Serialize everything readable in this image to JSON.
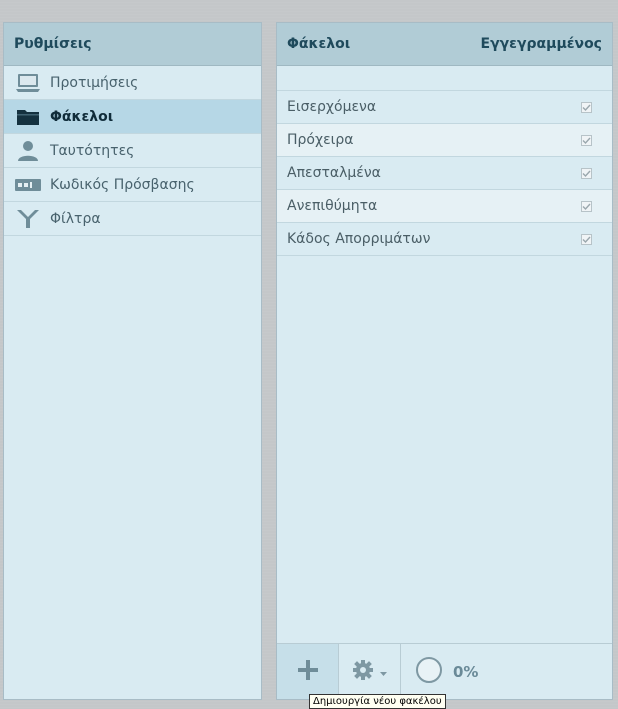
{
  "settings": {
    "title": "Ρυθμίσεις",
    "items": [
      {
        "label": "Προτιμήσεις",
        "icon": "monitor-icon"
      },
      {
        "label": "Φάκελοι",
        "icon": "folder-icon",
        "active": true
      },
      {
        "label": "Ταυτότητες",
        "icon": "person-icon"
      },
      {
        "label": "Κωδικός Πρόσβασης",
        "icon": "password-icon"
      },
      {
        "label": "Φίλτρα",
        "icon": "filter-icon"
      }
    ]
  },
  "folders": {
    "title": "Φάκελοι",
    "subscribed_header": "Εγγεγραμμένος",
    "rows": [
      {
        "name": "Εισερχόμενα",
        "subscribed": true
      },
      {
        "name": "Πρόχειρα",
        "subscribed": true
      },
      {
        "name": "Απεσταλμένα",
        "subscribed": true
      },
      {
        "name": "Ανεπιθύμητα",
        "subscribed": true
      },
      {
        "name": "Κάδος Απορριμάτων",
        "subscribed": true
      }
    ]
  },
  "footer": {
    "quota_percent": 0,
    "quota_text": "0%",
    "tooltip": "Δημιουργία νέου φακέλου"
  },
  "colors": {
    "panel_bg": "#d9ebf2",
    "header_bg": "#b1ccd6",
    "active_bg": "#b6d7e6",
    "title_text": "#1f4a5c"
  }
}
